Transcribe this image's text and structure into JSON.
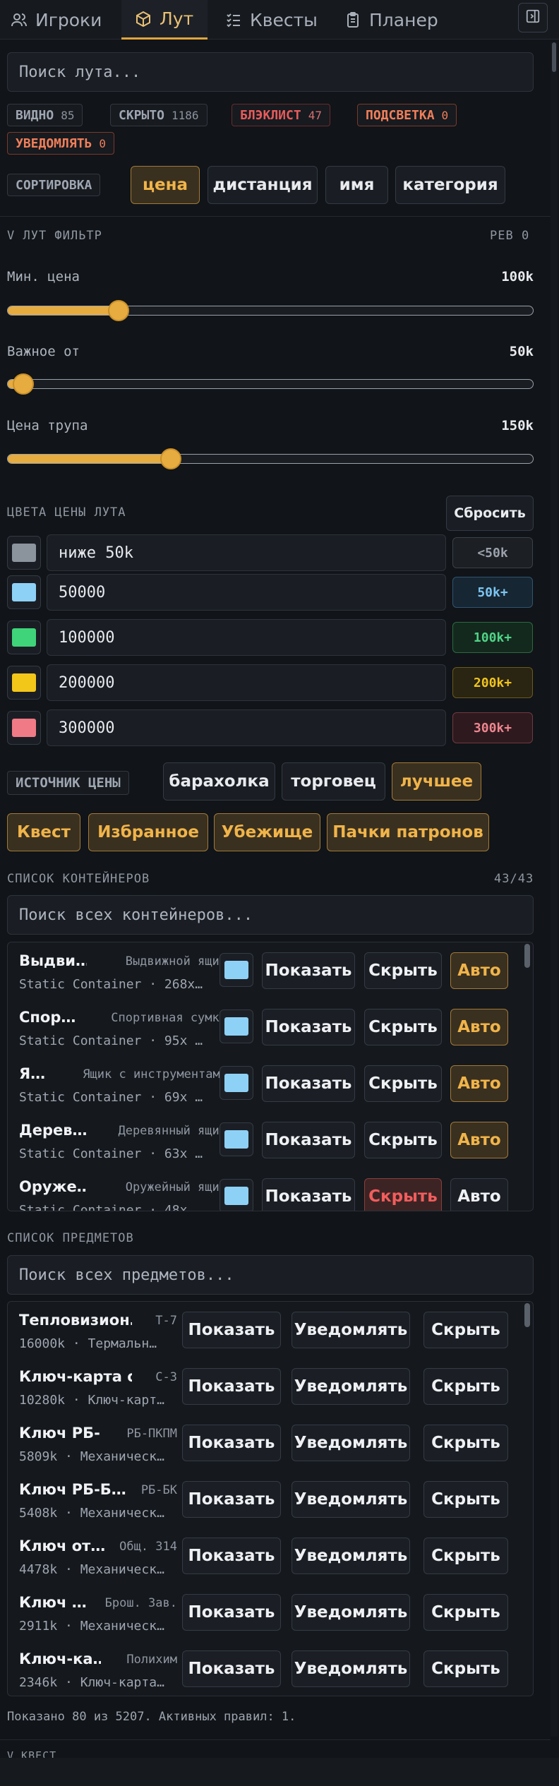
{
  "tabs": [
    {
      "label": "Игроки",
      "icon": "users-icon"
    },
    {
      "label": "Лут",
      "icon": "box-icon"
    },
    {
      "label": "Квесты",
      "icon": "checklist-icon"
    },
    {
      "label": "Планер",
      "icon": "clipboard-icon"
    }
  ],
  "search": {
    "placeholder": "Поиск лута..."
  },
  "stats": [
    {
      "label": "ВИДНО",
      "count": "85"
    },
    {
      "label": "СКРЫТО",
      "count": "1186"
    },
    {
      "label": "БЛЭКЛИСТ",
      "count": "47"
    },
    {
      "label": "ПОДСВЕТКА",
      "count": "0"
    },
    {
      "label": "УВЕДОМЛЯТЬ",
      "count": "0"
    }
  ],
  "sort": {
    "label": "СОРТИРОВКА",
    "options": [
      "цена",
      "дистанция",
      "имя",
      "категория"
    ],
    "selected": "цена"
  },
  "filter": {
    "title": "V ЛУТ ФИЛЬТР",
    "rev": "РЕВ 0",
    "sliders": [
      {
        "label": "Мин. цена",
        "value": "100k",
        "fraction": 0.21
      },
      {
        "label": "Важное от",
        "value": "50k",
        "fraction": 0.03
      },
      {
        "label": "Цена трупа",
        "value": "150k",
        "fraction": 0.31
      }
    ]
  },
  "colors": {
    "title": "ЦВЕТА ЦЕНЫ ЛУТА",
    "reset": "Сбросить",
    "rows": [
      {
        "value": "ниже 50k",
        "tag": "<50k",
        "swatch": "#8b939c",
        "tag_color": "#9aa1ab",
        "tag_bg": "#1c1f24",
        "tag_border": "#3a414b"
      },
      {
        "value": "50000",
        "tag": "50k+",
        "swatch": "#8ed1f7",
        "tag_color": "#7cc6f2",
        "tag_bg": "#172633",
        "tag_border": "#2f5570"
      },
      {
        "value": "100000",
        "tag": "100k+",
        "swatch": "#3fd47a",
        "tag_color": "#4fd487",
        "tag_bg": "#14291d",
        "tag_border": "#2a6a42"
      },
      {
        "value": "200000",
        "tag": "200k+",
        "swatch": "#f3c61a",
        "tag_color": "#f0c51d",
        "tag_bg": "#2a2412",
        "tag_border": "#6b5a1e"
      },
      {
        "value": "300000",
        "tag": "300k+",
        "swatch": "#f07a85",
        "tag_color": "#ef8590",
        "tag_bg": "#2e1a1e",
        "tag_border": "#6e3a42"
      }
    ]
  },
  "price_source": {
    "label": "ИСТОЧНИК ЦЕНЫ",
    "options": [
      "барахолка",
      "торговец",
      "лучшее"
    ],
    "selected": "лучшее"
  },
  "categories": [
    "Квест",
    "Избранное",
    "Убежище",
    "Пачки патронов"
  ],
  "containers": {
    "title": "СПИСОК КОНТЕЙНЕРОВ",
    "count": "43/43",
    "placeholder": "Поиск всех контейнеров...",
    "show": "Показать",
    "hide": "Скрыть",
    "auto": "Авто",
    "rows": [
      {
        "name": "Выдви…",
        "type": "Выдвижной ящик",
        "sub": "Static Container · 268x…",
        "hide_active": false,
        "auto_active": true
      },
      {
        "name": "Спор…",
        "type": "Спортивная сумка",
        "sub": "Static Container · 95x …",
        "hide_active": false,
        "auto_active": true
      },
      {
        "name": "Я…",
        "type": "Ящик с инструментами",
        "sub": "Static Container · 69x …",
        "hide_active": false,
        "auto_active": true
      },
      {
        "name": "Дерев…",
        "type": "Деревянный ящик",
        "sub": "Static Container · 63x …",
        "hide_active": false,
        "auto_active": true
      },
      {
        "name": "Оруже…",
        "type": "Оружейный ящик",
        "sub": "Static Container · 48x…",
        "hide_active": true,
        "auto_active": false
      }
    ]
  },
  "items": {
    "title": "СПИСОК ПРЕДМЕТОВ",
    "placeholder": "Поиск всех предметов...",
    "show": "Показать",
    "notify": "Уведомлять",
    "hide": "Скрыть",
    "rows": [
      {
        "name": "Тепловизион…",
        "short": "Т-7",
        "sub": "16000k · Термальн…"
      },
      {
        "name": "Ключ-карта о…",
        "short": "С-3",
        "sub": "10280k · Ключ-карт…"
      },
      {
        "name": "Ключ РБ-…",
        "short": "РБ-ПКПМ",
        "sub": "5809k · Механическ…"
      },
      {
        "name": "Ключ РБ-Б…",
        "short": "РБ-БК",
        "sub": "5408k · Механическ…"
      },
      {
        "name": "Ключ от…",
        "short": "Общ. 314",
        "sub": "4478k · Механическ…"
      },
      {
        "name": "Ключ …",
        "short": "Брош. Зав.",
        "sub": "2911k · Механическ…"
      },
      {
        "name": "Ключ-ка…",
        "short": "Полихим",
        "sub": "2346k · Ключ-карта…"
      }
    ]
  },
  "status": "Показано 80 из 5207. Активных правил: 1.",
  "next_section": "V КВЕСТ"
}
